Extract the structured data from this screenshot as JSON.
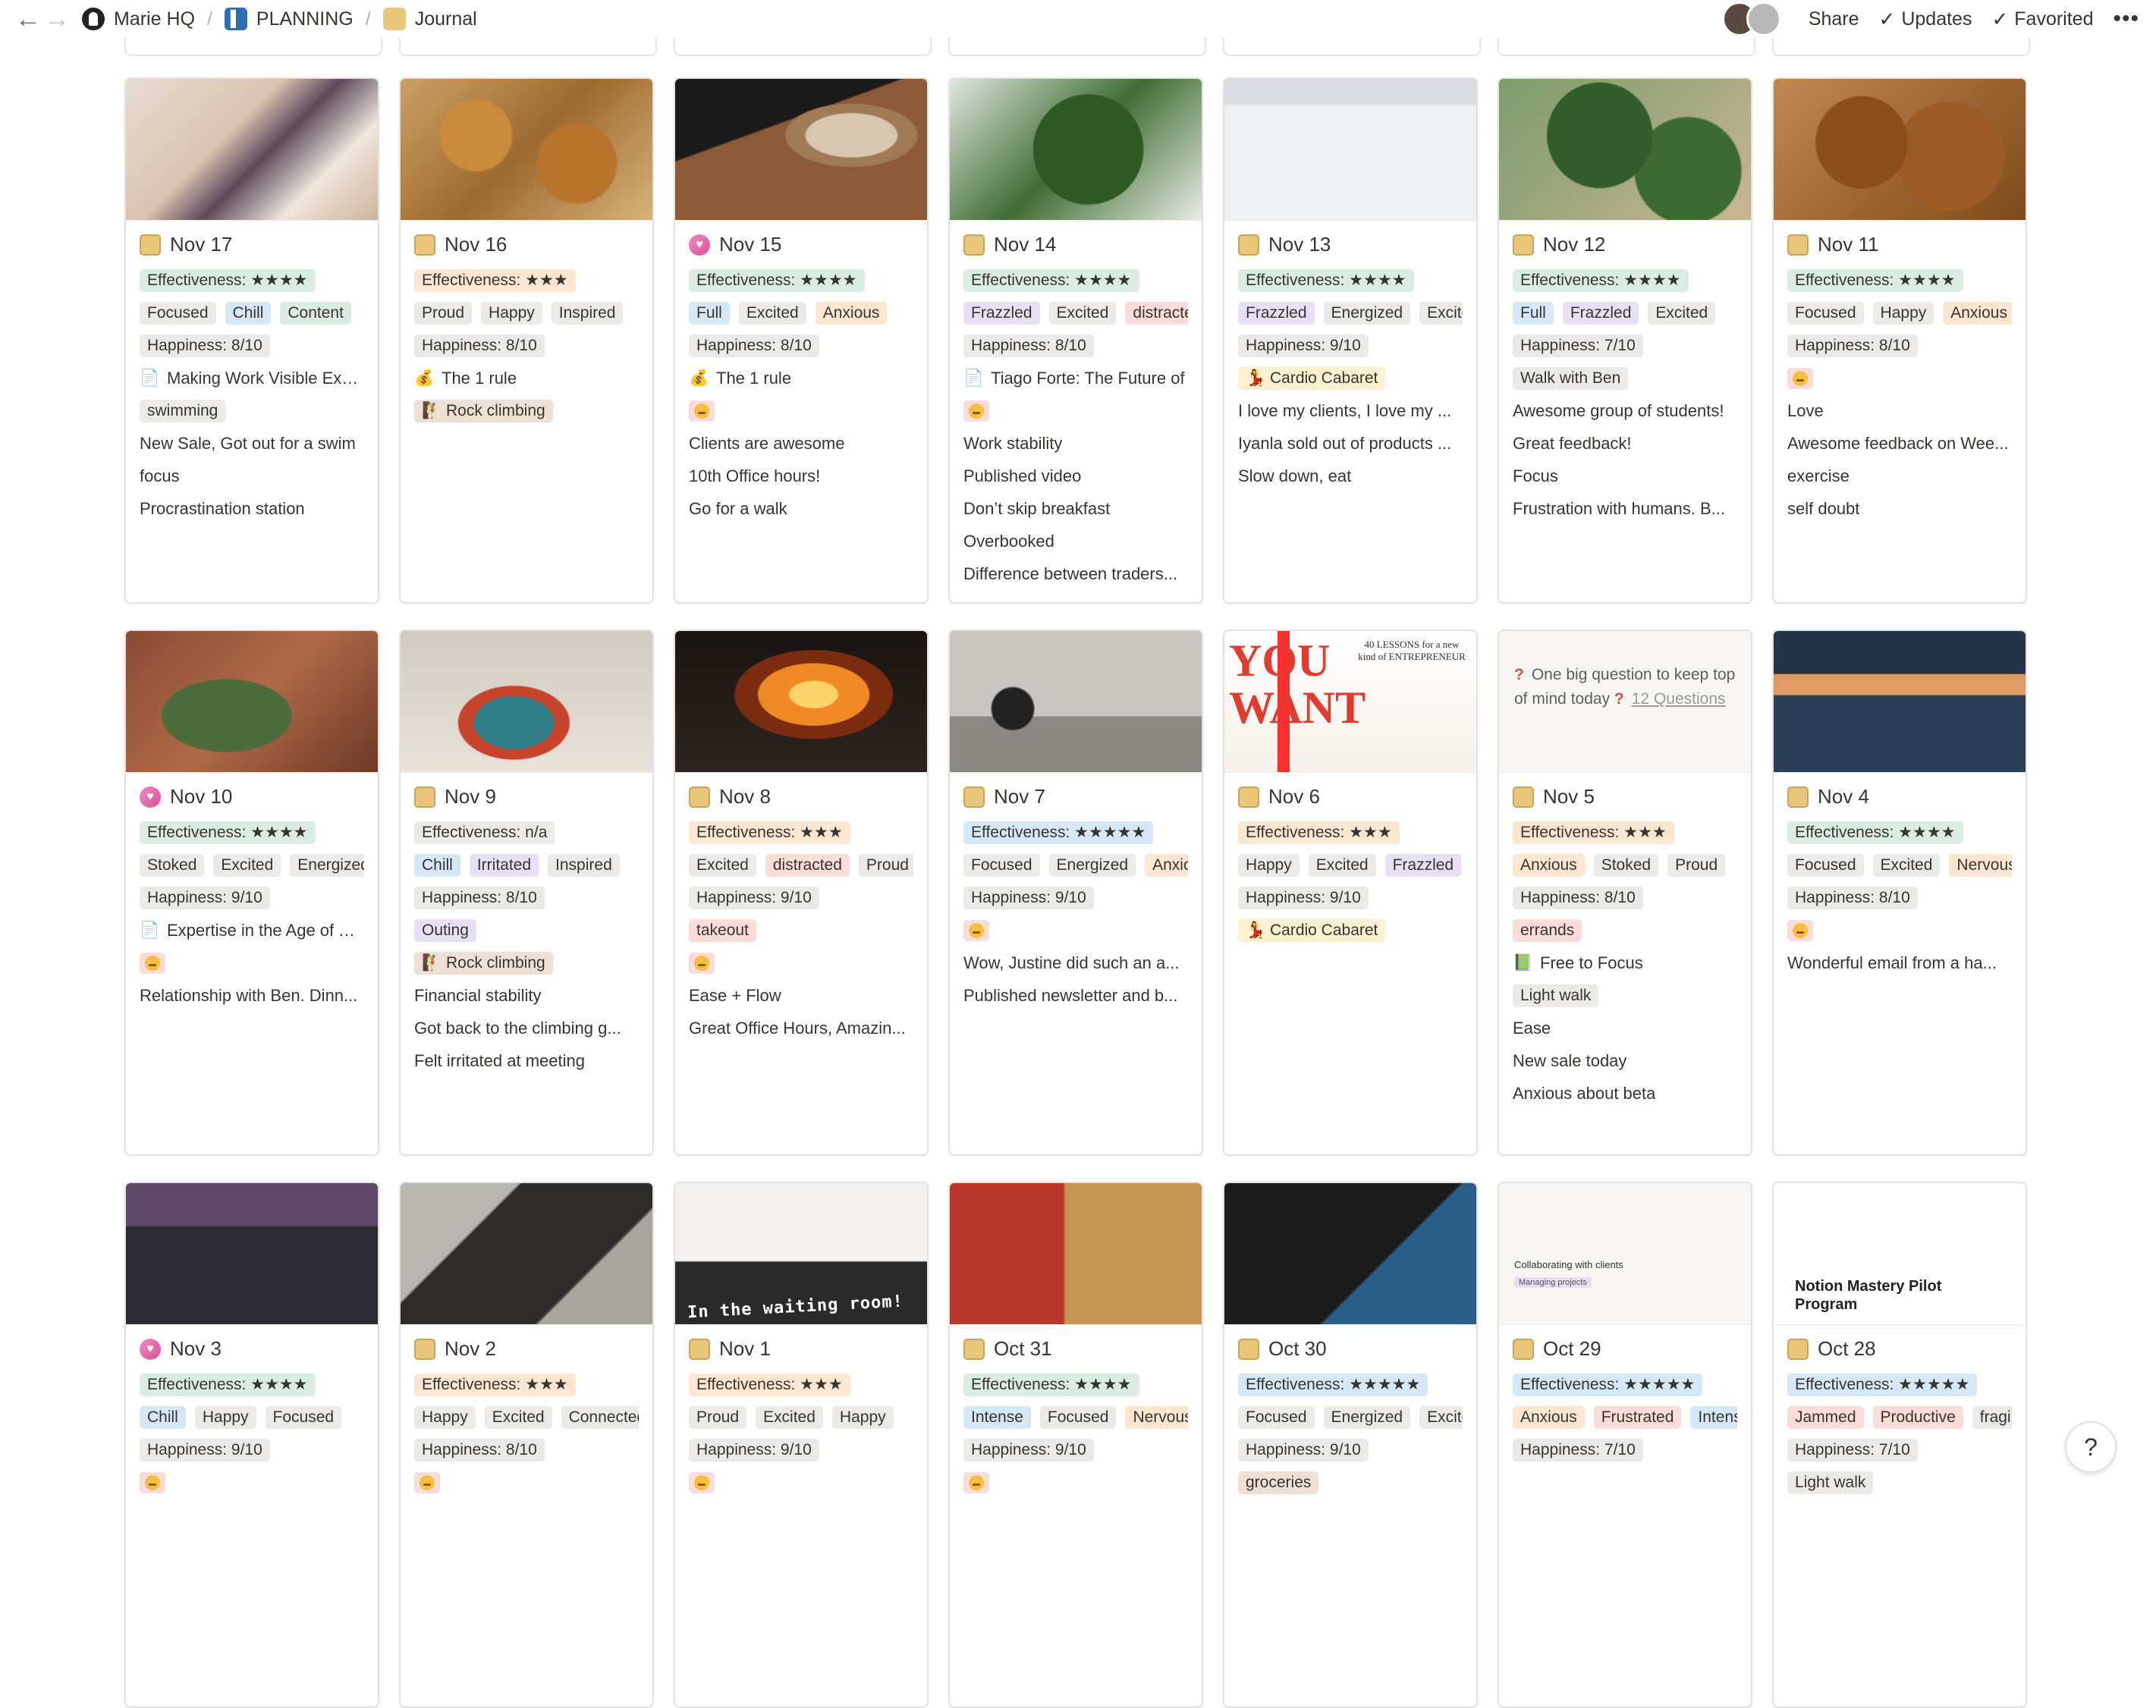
{
  "breadcrumb": [
    "Marie HQ",
    "PLANNING",
    "Journal"
  ],
  "top_right": {
    "share": "Share",
    "updates": "Updates",
    "favorited": "Favorited"
  },
  "help": "?",
  "cover_texts": {
    "waiting": "In the waiting room!",
    "collab": "Collaborating with clients",
    "managing": "Managing projects",
    "notion": "Notion Mastery Pilot Program",
    "book_title": "YOU WANT",
    "book_sub": "40 LESSONS for a new kind of ENTREPRENEUR"
  },
  "question_card": {
    "text": "One big question to keep top of mind today",
    "link": "12 Questions"
  },
  "cards": [
    {
      "title": "Nov 17",
      "icon": "journal",
      "lines": [
        [
          "Effectiveness: ★★★★",
          "green"
        ],
        [
          [
            "Focused",
            "gray"
          ],
          [
            "Chill",
            "blue"
          ],
          [
            "Content",
            "green"
          ]
        ],
        [
          "Happiness: 8/10",
          "gray"
        ],
        [
          "📄",
          "Making Work Visible Exposi"
        ],
        [
          "swimming",
          "gray"
        ],
        "New Sale, Got out for a swim",
        "focus",
        "Procrastination station"
      ]
    },
    {
      "title": "Nov 16",
      "icon": "journal",
      "lines": [
        [
          "Effectiveness: ★★★",
          "orange"
        ],
        [
          [
            "Proud",
            "gray"
          ],
          [
            "Happy",
            "gray"
          ],
          [
            "Inspired",
            "gray"
          ]
        ],
        [
          "Happiness: 8/10",
          "gray"
        ],
        [
          "💰",
          "The 1 rule"
        ],
        [
          "🧗",
          "Rock climbing",
          "brown"
        ]
      ]
    },
    {
      "title": "Nov 15",
      "icon": "heart",
      "lines": [
        [
          "Effectiveness: ★★★★",
          "green"
        ],
        [
          [
            "Full",
            "blue"
          ],
          [
            "Excited",
            "gray"
          ],
          [
            "Anxious",
            "orange"
          ]
        ],
        [
          "Happiness: 8/10",
          "gray"
        ],
        [
          "💰",
          "The 1 rule"
        ],
        "EMOJI",
        "Clients are awesome",
        "10th Office hours!",
        "Go for a walk"
      ]
    },
    {
      "title": "Nov 14",
      "icon": "journal",
      "lines": [
        [
          "Effectiveness: ★★★★",
          "green"
        ],
        [
          [
            "Frazzled",
            "purple"
          ],
          [
            "Excited",
            "gray"
          ],
          [
            "distracted",
            "red"
          ]
        ],
        [
          "Happiness: 8/10",
          "gray"
        ],
        [
          "📄",
          "Tiago Forte: The Future of"
        ],
        "EMOJI",
        "Work stability",
        "Published video",
        "Don’t skip breakfast",
        "Overbooked",
        "Difference between traders..."
      ]
    },
    {
      "title": "Nov 13",
      "icon": "journal",
      "lines": [
        [
          "Effectiveness: ★★★★",
          "green"
        ],
        [
          [
            "Frazzled",
            "purple"
          ],
          [
            "Energized",
            "gray"
          ],
          [
            "Excited",
            "gray"
          ]
        ],
        [
          "Happiness: 9/10",
          "gray"
        ],
        [
          "💃",
          "Cardio Cabaret",
          "yellow"
        ],
        "I love my clients, I love my ...",
        "Iyanla sold out of products ...",
        "Slow down, eat"
      ]
    },
    {
      "title": "Nov 12",
      "icon": "journal",
      "lines": [
        [
          "Effectiveness: ★★★★",
          "green"
        ],
        [
          [
            "Full",
            "blue"
          ],
          [
            "Frazzled",
            "purple"
          ],
          [
            "Excited",
            "gray"
          ]
        ],
        [
          "Happiness: 7/10",
          "gray"
        ],
        [
          "Walk with Ben",
          "gray"
        ],
        "Awesome group of students!",
        "Great feedback!",
        "Focus",
        "Frustration with humans. B..."
      ]
    },
    {
      "title": "Nov 11",
      "icon": "journal",
      "lines": [
        [
          "Effectiveness: ★★★★",
          "green"
        ],
        [
          [
            "Focused",
            "gray"
          ],
          [
            "Happy",
            "gray"
          ],
          [
            "Anxious",
            "orange"
          ]
        ],
        [
          "Happiness: 8/10",
          "gray"
        ],
        "EMOJI",
        "Love",
        "Awesome feedback on Wee...",
        "exercise",
        "self doubt"
      ]
    },
    {
      "title": "Nov 10",
      "icon": "heart",
      "lines": [
        [
          "Effectiveness: ★★★★",
          "green"
        ],
        [
          [
            "Stoked",
            "gray"
          ],
          [
            "Excited",
            "gray"
          ],
          [
            "Energized",
            "gray"
          ]
        ],
        [
          "Happiness: 9/10",
          "gray"
        ],
        [
          "📄",
          "Expertise in the Age of You"
        ],
        "EMOJI",
        "Relationship with Ben. Dinn..."
      ]
    },
    {
      "title": "Nov 9",
      "icon": "journal",
      "lines": [
        [
          "Effectiveness: n/a",
          "gray"
        ],
        [
          [
            "Chill",
            "blue"
          ],
          [
            "Irritated",
            "purple"
          ],
          [
            "Inspired",
            "gray"
          ]
        ],
        [
          "Happiness: 8/10",
          "gray"
        ],
        [
          "Outing",
          "purple"
        ],
        [
          "🧗",
          "Rock climbing",
          "brown"
        ],
        "Financial stability",
        "Got back to the climbing g...",
        "Felt irritated at meeting"
      ]
    },
    {
      "title": "Nov 8",
      "icon": "journal",
      "lines": [
        [
          "Effectiveness: ★★★",
          "orange"
        ],
        [
          [
            "Excited",
            "gray"
          ],
          [
            "distracted",
            "red"
          ],
          [
            "Proud",
            "gray"
          ]
        ],
        [
          "Happiness: 9/10",
          "gray"
        ],
        [
          "takeout",
          "red"
        ],
        "EMOJI",
        "Ease + Flow",
        "Great Office Hours, Amazin..."
      ]
    },
    {
      "title": "Nov 7",
      "icon": "journal",
      "lines": [
        [
          "Effectiveness: ★★★★★",
          "blue"
        ],
        [
          [
            "Focused",
            "gray"
          ],
          [
            "Energized",
            "gray"
          ],
          [
            "Anxious",
            "orange"
          ]
        ],
        [
          "Happiness: 9/10",
          "gray"
        ],
        "EMOJI",
        "Wow, Justine did such an a...",
        "Published newsletter and b..."
      ]
    },
    {
      "title": "Nov 6",
      "icon": "journal",
      "lines": [
        [
          "Effectiveness: ★★★",
          "orange"
        ],
        [
          [
            "Happy",
            "gray"
          ],
          [
            "Excited",
            "gray"
          ],
          [
            "Frazzled",
            "purple"
          ]
        ],
        [
          "Happiness: 9/10",
          "gray"
        ],
        [
          "💃",
          "Cardio Cabaret",
          "yellow"
        ]
      ]
    },
    {
      "title": "Nov 5",
      "icon": "journal",
      "lines": [
        [
          "Effectiveness: ★★★",
          "orange"
        ],
        [
          [
            "Anxious",
            "orange"
          ],
          [
            "Stoked",
            "gray"
          ],
          [
            "Proud",
            "gray"
          ]
        ],
        [
          "Happiness: 8/10",
          "gray"
        ],
        [
          "errands",
          "red"
        ],
        [
          "📗",
          "Free to Focus"
        ],
        [
          "Light walk",
          "gray"
        ],
        "Ease",
        "New sale today",
        "Anxious about beta"
      ]
    },
    {
      "title": "Nov 4",
      "icon": "journal",
      "lines": [
        [
          "Effectiveness: ★★★★",
          "green"
        ],
        [
          [
            "Focused",
            "gray"
          ],
          [
            "Excited",
            "gray"
          ],
          [
            "Nervous",
            "orange"
          ]
        ],
        [
          "Happiness: 8/10",
          "gray"
        ],
        "EMOJI",
        "Wonderful email from a ha..."
      ]
    },
    {
      "title": "Nov 3",
      "icon": "heart",
      "lines": [
        [
          "Effectiveness: ★★★★",
          "green"
        ],
        [
          [
            "Chill",
            "blue"
          ],
          [
            "Happy",
            "gray"
          ],
          [
            "Focused",
            "gray"
          ]
        ],
        [
          "Happiness: 9/10",
          "gray"
        ],
        "EMOJI"
      ]
    },
    {
      "title": "Nov 2",
      "icon": "journal",
      "lines": [
        [
          "Effectiveness: ★★★",
          "orange"
        ],
        [
          [
            "Happy",
            "gray"
          ],
          [
            "Excited",
            "gray"
          ],
          [
            "Connected",
            "gray"
          ]
        ],
        [
          "Happiness: 8/10",
          "gray"
        ],
        "EMOJI"
      ]
    },
    {
      "title": "Nov 1",
      "icon": "journal",
      "lines": [
        [
          "Effectiveness: ★★★",
          "orange"
        ],
        [
          [
            "Proud",
            "gray"
          ],
          [
            "Excited",
            "gray"
          ],
          [
            "Happy",
            "gray"
          ]
        ],
        [
          "Happiness: 9/10",
          "gray"
        ],
        "EMOJI"
      ]
    },
    {
      "title": "Oct 31",
      "icon": "journal",
      "lines": [
        [
          "Effectiveness: ★★★★",
          "green"
        ],
        [
          [
            "Intense",
            "blue"
          ],
          [
            "Focused",
            "gray"
          ],
          [
            "Nervous",
            "orange"
          ]
        ],
        [
          "Happiness: 9/10",
          "gray"
        ],
        "EMOJI"
      ]
    },
    {
      "title": "Oct 30",
      "icon": "journal",
      "lines": [
        [
          "Effectiveness: ★★★★★",
          "blue"
        ],
        [
          [
            "Focused",
            "gray"
          ],
          [
            "Energized",
            "gray"
          ],
          [
            "Excited",
            "gray"
          ]
        ],
        [
          "Happiness: 9/10",
          "gray"
        ],
        [
          "groceries",
          "brown"
        ]
      ]
    },
    {
      "title": "Oct 29",
      "icon": "journal",
      "lines": [
        [
          "Effectiveness: ★★★★★",
          "blue"
        ],
        [
          [
            "Anxious",
            "orange"
          ],
          [
            "Frustrated",
            "red"
          ],
          [
            "Intense",
            "blue"
          ]
        ],
        [
          "Happiness: 7/10",
          "gray"
        ]
      ]
    },
    {
      "title": "Oct 28",
      "icon": "journal",
      "lines": [
        [
          "Effectiveness: ★★★★★",
          "blue"
        ],
        [
          [
            "Jammed",
            "red"
          ],
          [
            "Productive",
            "red"
          ],
          [
            "fragile",
            "gray"
          ]
        ],
        [
          "Happiness: 7/10",
          "gray"
        ],
        [
          "Light walk",
          "gray"
        ]
      ]
    }
  ]
}
